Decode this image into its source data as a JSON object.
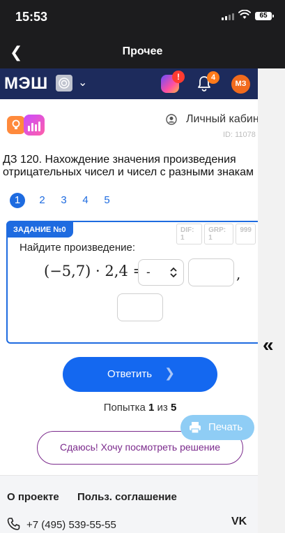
{
  "status_bar": {
    "time": "15:53",
    "battery": "65"
  },
  "nav": {
    "title": "Прочее"
  },
  "app_header": {
    "logo": "МЭШ",
    "app_alert": "!",
    "notifications_count": "4",
    "avatar_initials": "МЗ"
  },
  "sub_header": {
    "cabinet_label": "Личный кабин",
    "cabinet_id": "ID: 11078"
  },
  "task": {
    "title_line1": "ДЗ 120. Нахождение значения произведения",
    "title_line2": "отрицательных чисел и чисел с разными знакам"
  },
  "pages": [
    "1",
    "2",
    "3",
    "4",
    "5"
  ],
  "exercise": {
    "label": "ЗАДАНИЕ №0",
    "chips": [
      "DIF: 1",
      "GRP: 1",
      "999"
    ],
    "prompt": "Найдите произведение:",
    "expression": "(−5,7) · 2,4 =",
    "select_value": "-",
    "comma": ","
  },
  "actions": {
    "answer_label": "Ответить",
    "attempt_prefix": "Попытка",
    "attempt_current": "1",
    "attempt_of": "из",
    "attempt_total": "5",
    "give_up_label": "Сдаюсь! Хочу посмотреть решение",
    "print_label": "Печать"
  },
  "footer": {
    "about": "О проекте",
    "agreement": "Польз. соглашение",
    "phone": "+7 (495) 539-55-55",
    "vk": "VK"
  },
  "colors": {
    "accent": "#1468f0",
    "header": "#1d2b5c",
    "giveup": "#7b2a8c"
  }
}
